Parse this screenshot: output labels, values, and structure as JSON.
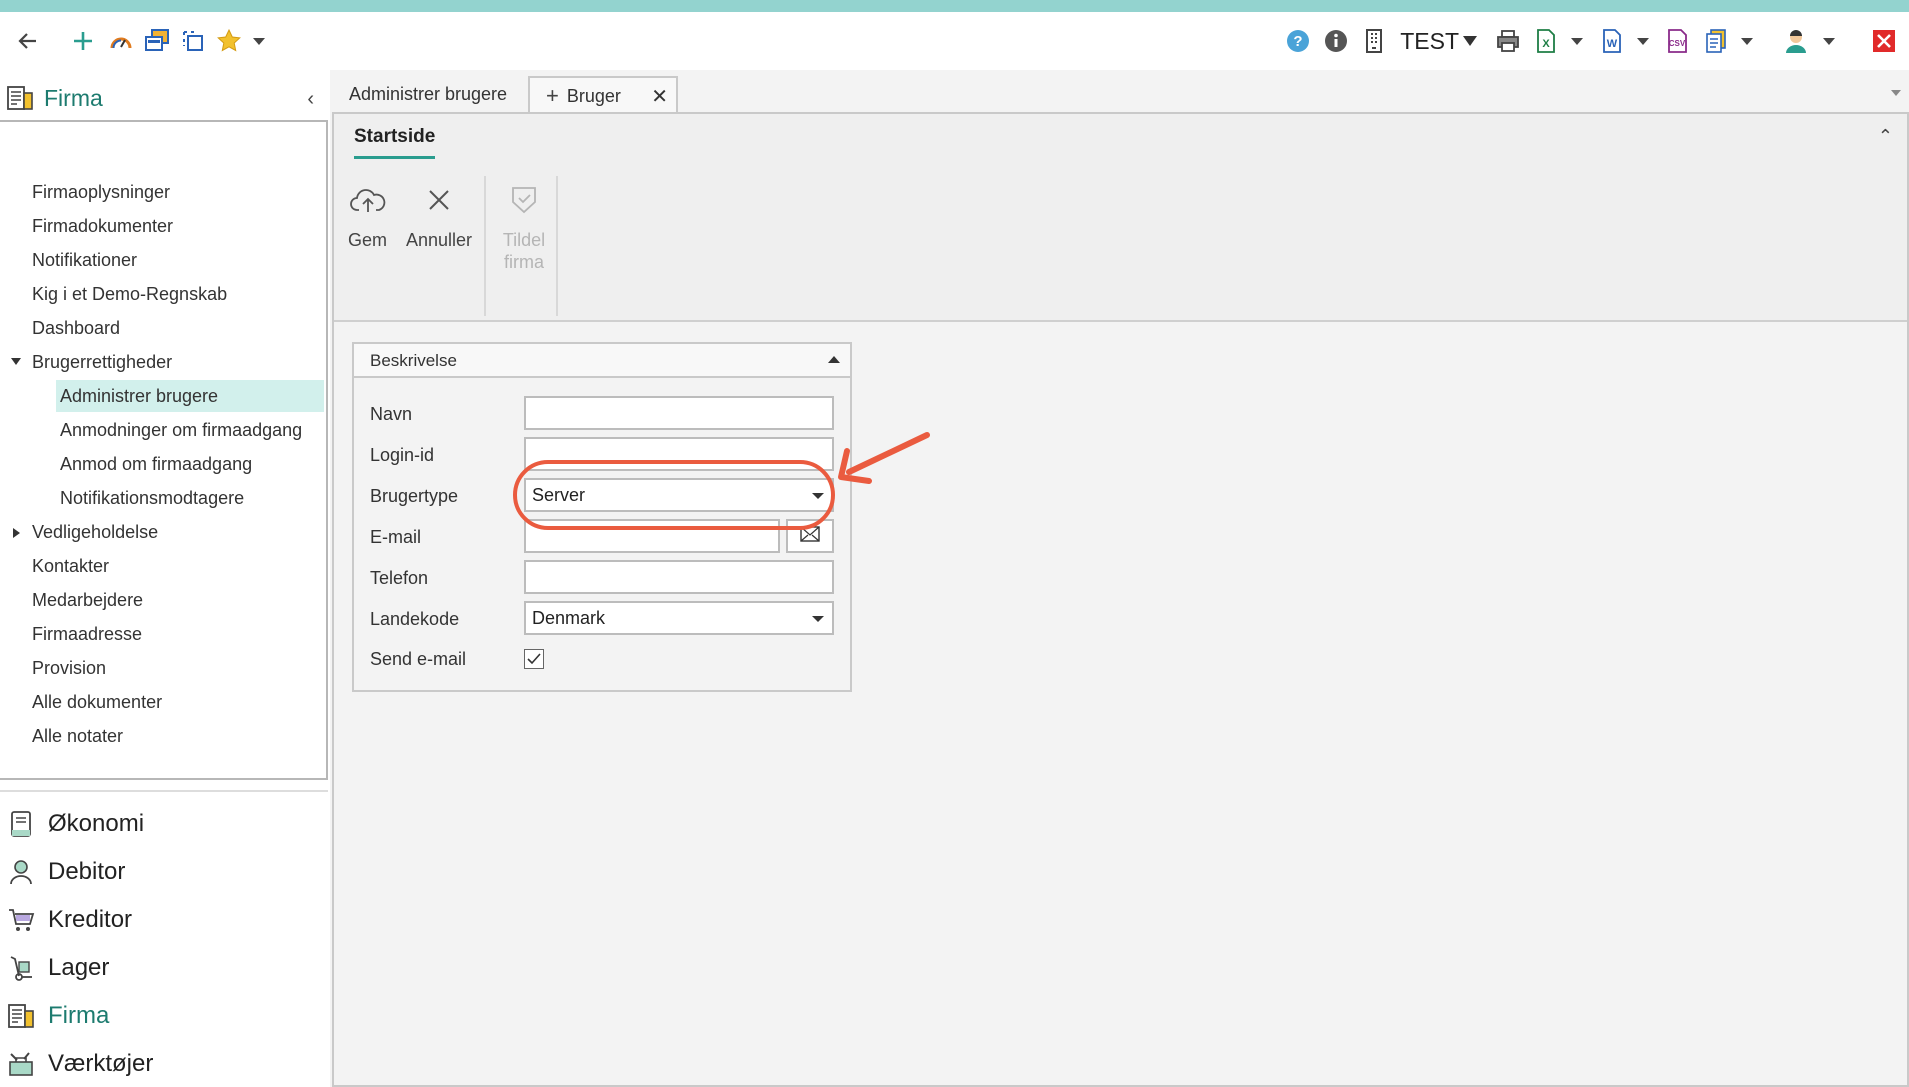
{
  "toolbar": {
    "left_icons": [
      "back-arrow-icon",
      "plus-icon",
      "dashboard-gauge-icon",
      "windows-icon",
      "copy-icon",
      "star-icon"
    ],
    "test_label": "TEST",
    "right_icons": [
      "help-icon",
      "info-icon",
      "building-icon",
      "printer-icon",
      "excel-icon",
      "word-icon",
      "csv-icon",
      "document-icon",
      "user-avatar-icon",
      "close-window-icon"
    ]
  },
  "left_panel": {
    "title": "Firma",
    "tree": [
      {
        "label": "Firmaoplysninger"
      },
      {
        "label": "Firmadokumenter"
      },
      {
        "label": "Notifikationer"
      },
      {
        "label": "Kig i et Demo-Regnskab"
      },
      {
        "label": "Dashboard"
      },
      {
        "label": "Brugerrettigheder"
      },
      {
        "label": "Administrer brugere"
      },
      {
        "label": "Anmodninger om firmaadgang"
      },
      {
        "label": "Anmod om firmaadgang"
      },
      {
        "label": "Notifikationsmodtagere"
      },
      {
        "label": "Vedligeholdelse"
      },
      {
        "label": "Kontakter"
      },
      {
        "label": "Medarbejdere"
      },
      {
        "label": "Firmaadresse"
      },
      {
        "label": "Provision"
      },
      {
        "label": "Alle dokumenter"
      },
      {
        "label": "Alle notater"
      }
    ],
    "modules": [
      {
        "label": "Økonomi"
      },
      {
        "label": "Debitor"
      },
      {
        "label": "Kreditor"
      },
      {
        "label": "Lager"
      },
      {
        "label": "Firma"
      },
      {
        "label": "Værktøjer"
      }
    ]
  },
  "tabs": [
    {
      "label": "Administrer brugere"
    },
    {
      "label": "Bruger"
    }
  ],
  "ribbon": {
    "tab": "Startside",
    "buttons": [
      {
        "label": "Gem"
      },
      {
        "label": "Annuller"
      },
      {
        "label": "Tildel firma"
      }
    ]
  },
  "form": {
    "group_title": "Beskrivelse",
    "fields": {
      "navn": {
        "label": "Navn",
        "value": ""
      },
      "login": {
        "label": "Login-id",
        "value": ""
      },
      "brugertype": {
        "label": "Brugertype",
        "value": "Server"
      },
      "email": {
        "label": "E-mail",
        "value": ""
      },
      "telefon": {
        "label": "Telefon",
        "value": ""
      },
      "landekode": {
        "label": "Landekode",
        "value": "Denmark"
      },
      "send_email": {
        "label": "Send e-mail",
        "checked": true
      }
    }
  },
  "colors": {
    "accent_strip": "#93d3cf",
    "brand_teal": "#1d7b6f",
    "selected_row": "#d2f0ec",
    "annotation": "#ea5b3f"
  }
}
